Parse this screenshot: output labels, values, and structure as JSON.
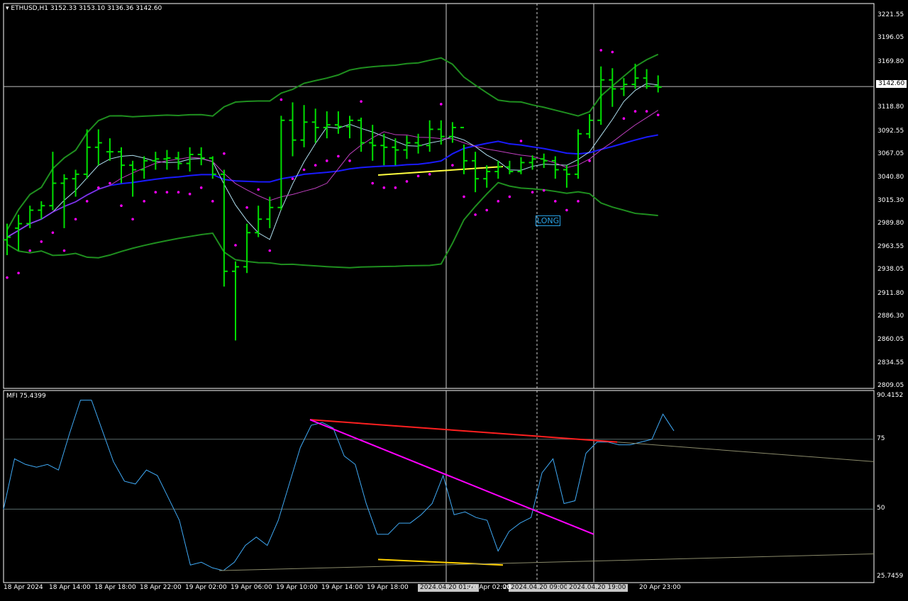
{
  "header": {
    "symbol": "ETHUSD,H1",
    "ohlc": "3152.33 3153.10 3136.36 3142.60"
  },
  "mfi_header": "MFI 75.4399",
  "current_price_label": "3142.60",
  "annotation": "LONG",
  "crosshair_times": [
    "2024.04.20 01:00",
    "2024.04.20 09:00",
    "2024.04.20 19:00"
  ],
  "colors": {
    "bars": "#00e000",
    "bb_upper_lower": "#1f8f1f",
    "bb_red": "#ff0000",
    "ma_blue": "#1a1aff",
    "ma_cyan": "#b0e0f0",
    "ma_violet": "#c040c0",
    "psar": "#ff00ff",
    "mfi_line": "#3fa9f5",
    "trend_red": "#ff2020",
    "trend_magenta": "#ff00ff",
    "trend_yellow": "#ffd000",
    "price_yellow": "#ffff40"
  },
  "chart_data": [
    {
      "type": "bar",
      "title": "ETHUSD,H1",
      "ylim": [
        2809.05,
        3221.55
      ],
      "yticks": [
        "3221.55",
        "3196.05",
        "3169.80",
        "3142.60",
        "3118.80",
        "3092.55",
        "3067.05",
        "3040.80",
        "3015.30",
        "2989.80",
        "2963.55",
        "2938.05",
        "2911.80",
        "2886.30",
        "2860.05",
        "2834.55",
        "2809.05"
      ],
      "xticks": [
        "18 Apr 2024",
        "18 Apr 14:00",
        "18 Apr 18:00",
        "18 Apr 22:00",
        "19 Apr 02:00",
        "19 Apr 06:00",
        "19 Apr 10:00",
        "19 Apr 14:00",
        "19 Apr 18:00",
        "2024.04.20 01:00",
        "20 Apr 02:00",
        "20",
        "2024.04.20 09:00",
        "2024.04.20 19:00",
        "20 Apr 23:00"
      ],
      "ohlc": [
        [
          2972,
          2990,
          2955,
          2975
        ],
        [
          2985,
          3000,
          2960,
          2990
        ],
        [
          2990,
          3010,
          2985,
          3005
        ],
        [
          3005,
          3015,
          2995,
          3010
        ],
        [
          3010,
          3070,
          3005,
          3035
        ],
        [
          3035,
          3045,
          2985,
          3040
        ],
        [
          3040,
          3050,
          3020,
          3045
        ],
        [
          3045,
          3095,
          3040,
          3075
        ],
        [
          3075,
          3095,
          3055,
          3080
        ],
        [
          3070,
          3085,
          3060,
          3070
        ],
        [
          3070,
          3075,
          3035,
          3055
        ],
        [
          3055,
          3060,
          3020,
          3050
        ],
        [
          3050,
          3065,
          3040,
          3060
        ],
        [
          3060,
          3070,
          3050,
          3062
        ],
        [
          3062,
          3072,
          3050,
          3063
        ],
        [
          3063,
          3070,
          3050,
          3057
        ],
        [
          3057,
          3075,
          3048,
          3067
        ],
        [
          3067,
          3075,
          3055,
          3063
        ],
        [
          3063,
          3065,
          3040,
          3045
        ],
        [
          3045,
          3050,
          2920,
          2937
        ],
        [
          2937,
          2948,
          2860,
          2942
        ],
        [
          2942,
          2990,
          2935,
          2980
        ],
        [
          2980,
          3010,
          2975,
          2995
        ],
        [
          2995,
          3020,
          2985,
          3008
        ],
        [
          3008,
          3110,
          3005,
          3105
        ],
        [
          3105,
          3125,
          3065,
          3083
        ],
        [
          3083,
          3122,
          3075,
          3103
        ],
        [
          3103,
          3118,
          3080,
          3097
        ],
        [
          3097,
          3115,
          3085,
          3100
        ],
        [
          3100,
          3115,
          3090,
          3098
        ],
        [
          3098,
          3110,
          3085,
          3105
        ],
        [
          3105,
          3108,
          3070,
          3080
        ],
        [
          3080,
          3100,
          3060,
          3077
        ],
        [
          3077,
          3090,
          3055,
          3075
        ],
        [
          3075,
          3085,
          3055,
          3072
        ],
        [
          3072,
          3088,
          3062,
          3080
        ],
        [
          3080,
          3090,
          3068,
          3077
        ],
        [
          3077,
          3105,
          3070,
          3095
        ],
        [
          3095,
          3105,
          3078,
          3087
        ],
        [
          3087,
          3103,
          3080,
          3097
        ],
        [
          3097,
          3078,
          3045,
          3060
        ],
        [
          3060,
          3070,
          3025,
          3040
        ],
        [
          3040,
          3055,
          3030,
          3048
        ],
        [
          3048,
          3060,
          3040,
          3053
        ],
        [
          3053,
          3060,
          3045,
          3048
        ],
        [
          3048,
          3064,
          3045,
          3058
        ],
        [
          3058,
          3066,
          3050,
          3062
        ],
        [
          3062,
          3068,
          3052,
          3060
        ],
        [
          3060,
          3065,
          3040,
          3050
        ],
        [
          3050,
          3055,
          3030,
          3045
        ],
        [
          3045,
          3095,
          3040,
          3090
        ],
        [
          3090,
          3112,
          3085,
          3105
        ],
        [
          3105,
          3165,
          3100,
          3150
        ],
        [
          3150,
          3163,
          3120,
          3140
        ],
        [
          3140,
          3152,
          3132,
          3145
        ],
        [
          3145,
          3168,
          3140,
          3152
        ],
        [
          3152,
          3162,
          3140,
          3143
        ],
        [
          3143,
          3155,
          3136,
          3142
        ]
      ],
      "series": [
        {
          "name": "",
          "role": "bb_upper",
          "values": []
        },
        {
          "name": "",
          "role": "bb_lower",
          "values": []
        }
      ]
    },
    {
      "type": "line",
      "title": "MFI 75.4399",
      "ylim": [
        25.7459,
        90.4152
      ],
      "yticks": [
        "90.4152",
        "75",
        "50",
        "25.7459"
      ],
      "values": [
        50,
        68,
        66,
        65,
        66,
        64,
        77,
        89,
        89,
        78,
        67,
        60,
        59,
        64,
        62,
        54,
        46,
        30,
        31,
        29,
        28,
        31,
        37,
        40,
        37,
        46,
        59,
        72,
        80,
        81,
        79,
        69,
        66,
        52,
        41,
        41,
        45,
        45,
        48,
        52,
        62,
        48,
        49,
        47,
        46,
        35,
        42,
        45,
        47,
        63,
        68,
        52,
        53,
        70,
        74,
        74,
        73,
        73,
        74,
        75,
        84,
        78
      ],
      "levels": [
        75,
        50
      ]
    }
  ]
}
